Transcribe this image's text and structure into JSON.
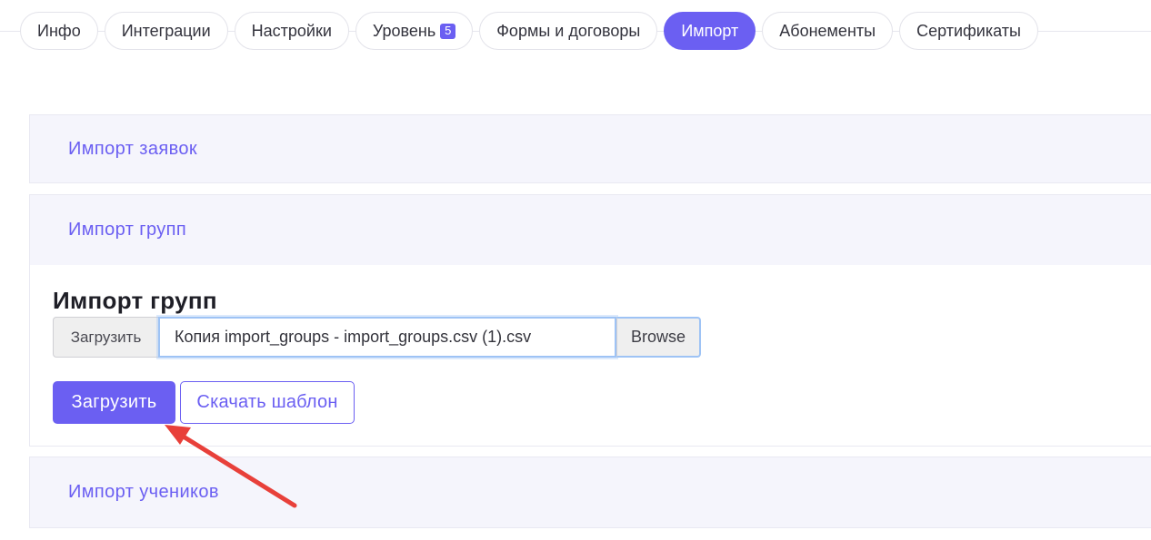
{
  "tabs": [
    {
      "label": "Инфо"
    },
    {
      "label": "Интеграции"
    },
    {
      "label": "Настройки"
    },
    {
      "label": "Уровень",
      "badge": "5"
    },
    {
      "label": "Формы и договоры"
    },
    {
      "label": "Импорт",
      "active": true
    },
    {
      "label": "Абонементы"
    },
    {
      "label": "Сертификаты"
    }
  ],
  "accordion": {
    "requests_header": "Импорт заявок",
    "groups_header": "Импорт групп",
    "students_header": "Импорт учеников"
  },
  "groups_panel": {
    "title": "Импорт групп",
    "file_prefix_label": "Загрузить",
    "file_name": "Копия import_groups - import_groups.csv (1).csv",
    "browse_label": "Browse",
    "upload_button": "Загрузить",
    "template_button": "Скачать шаблон"
  },
  "colors": {
    "accent": "#6b5ff2",
    "annotation_arrow": "#e8403a"
  }
}
